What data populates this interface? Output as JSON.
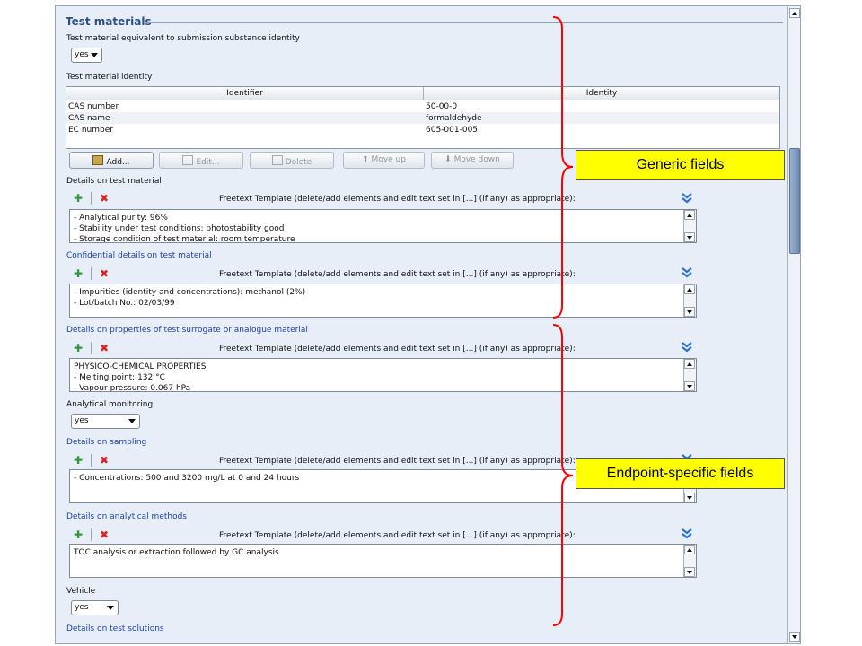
{
  "section": {
    "title": "Test materials"
  },
  "equiv": {
    "label": "Test material equivalent to submission substance identity",
    "value": "yes"
  },
  "identity": {
    "label": "Test material identity",
    "columns": [
      "Identifier",
      "Identity"
    ],
    "rows": [
      {
        "identifier": "CAS number",
        "identity": "50-00-0"
      },
      {
        "identifier": "CAS name",
        "identity": "formaldehyde"
      },
      {
        "identifier": "EC number",
        "identity": "605-001-005"
      }
    ],
    "buttons": {
      "add": "Add...",
      "edit": "Edit...",
      "delete": "Delete",
      "move_up": "Move up",
      "move_down": "Move down"
    }
  },
  "freetext_template": "Freetext Template (delete/add elements and edit text set in [...] (if any) as appropriate):",
  "details_test_material": {
    "label": "Details on test material",
    "lines": [
      "- Analytical purity: 96%",
      "- Stability under test conditions: photostability good",
      "- Storage condition of test material: room temperature"
    ]
  },
  "confidential": {
    "label": "Confidential details on test material",
    "lines": [
      "- Impurities (identity and concentrations): methanol (2%)",
      "- Lot/batch No.: 02/03/99"
    ]
  },
  "surrogate": {
    "label": "Details on properties of test surrogate or analogue material",
    "lines": [
      "PHYSICO-CHEMICAL PROPERTIES",
      "- Melting point: 132 °C",
      "- Vapour pressure: 0.067 hPa"
    ]
  },
  "analytical_monitoring": {
    "label": "Analytical monitoring",
    "value": "yes"
  },
  "sampling": {
    "label": "Details on sampling",
    "lines": [
      "- Concentrations: 500 and 3200 mg/L at 0 and 24 hours"
    ]
  },
  "analytical_methods": {
    "label": "Details on analytical methods",
    "lines": [
      "TOC analysis or extraction followed by GC analysis"
    ]
  },
  "vehicle": {
    "label": "Vehicle",
    "value": "yes"
  },
  "test_solutions": {
    "label": "Details on test solutions"
  },
  "callouts": {
    "generic": "Generic fields",
    "endpoint": "Endpoint-specific fields"
  },
  "colors": {
    "panel_bg": "#e7eef7",
    "link_blue": "#1d43b0",
    "title_blue": "#2d4e86",
    "callout_yellow": "#ffff00",
    "brace_red": "#ff0000"
  },
  "icons": [
    "add-element-icon",
    "delete-element-icon",
    "expand-chevron-icon",
    "scroll-up-icon",
    "scroll-down-icon",
    "combo-arrow-icon"
  ]
}
